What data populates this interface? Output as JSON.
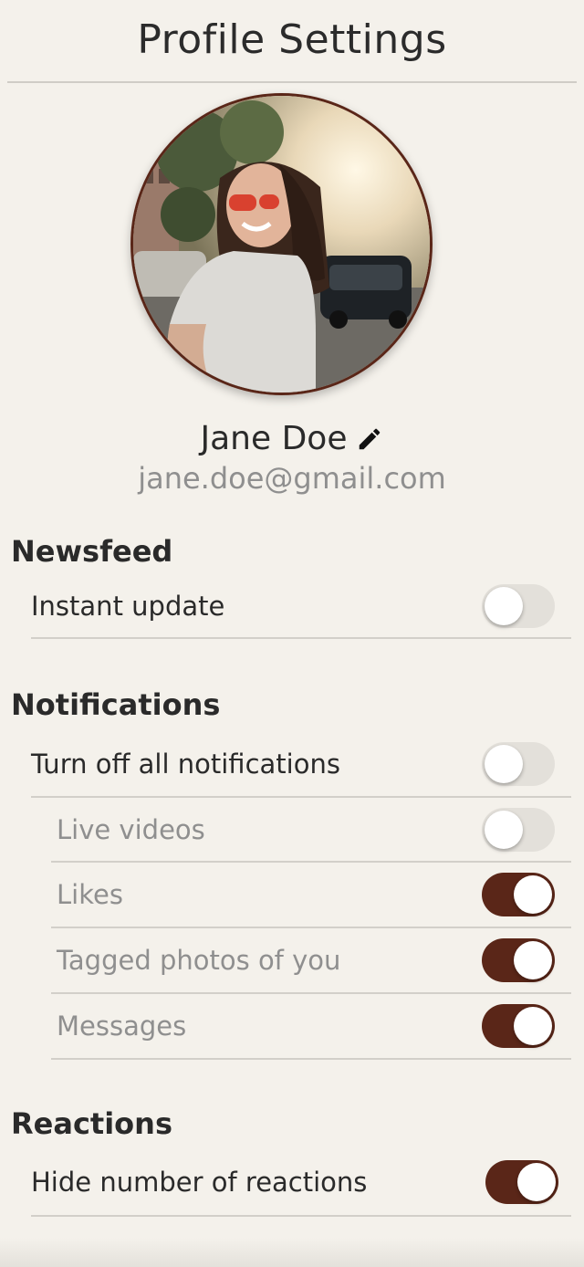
{
  "header": {
    "title": "Profile Settings"
  },
  "profile": {
    "name": "Jane Doe",
    "email": "jane.doe@gmail.com",
    "edit_icon": "pencil-icon"
  },
  "colors": {
    "accent": "#5a2618",
    "background": "#f4f1eb",
    "toggle_off": "#e3e0da"
  },
  "sections": {
    "newsfeed": {
      "title": "Newsfeed",
      "items": [
        {
          "label": "Instant update",
          "on": false
        }
      ]
    },
    "notifications": {
      "title": "Notifications",
      "items": [
        {
          "label": "Turn off all notifications",
          "on": false
        },
        {
          "label": "Live videos",
          "on": false
        },
        {
          "label": "Likes",
          "on": true
        },
        {
          "label": "Tagged photos of you",
          "on": true
        },
        {
          "label": "Messages",
          "on": true
        }
      ]
    },
    "reactions": {
      "title": "Reactions",
      "items": [
        {
          "label": "Hide number of reactions",
          "on": true
        }
      ]
    }
  }
}
